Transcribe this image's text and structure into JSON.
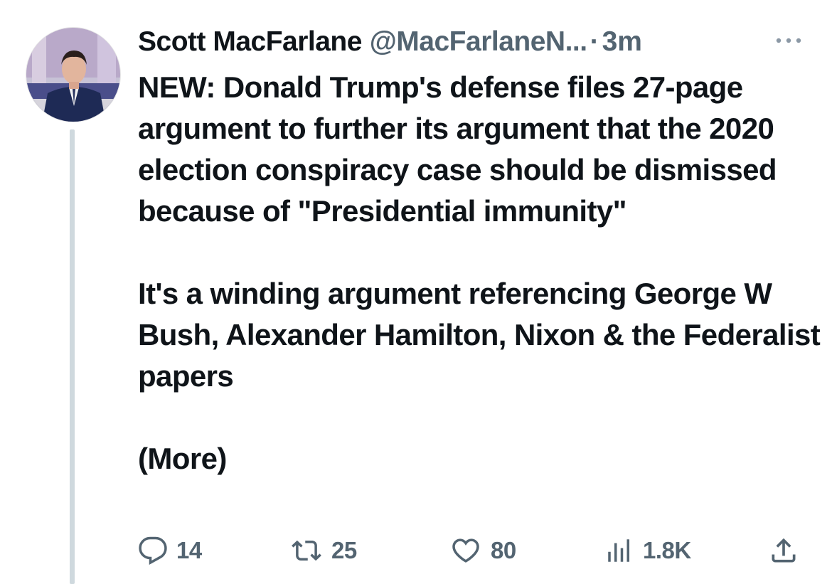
{
  "tweet": {
    "author_name": "Scott MacFarlane",
    "handle": "@MacFarlaneN...",
    "separator": "·",
    "time": "3m",
    "more_icon": "more-horizontal-icon",
    "paragraphs": [
      "NEW:  Donald Trump's defense files 27-page argument to further its argument that the 2020 election conspiracy case should be dismissed because of \"Presidential immunity\"",
      "It's a winding argument referencing George W Bush, Alexander Hamilton, Nixon & the Federalist papers",
      "(More)"
    ]
  },
  "actions": {
    "reply": {
      "icon": "reply-icon",
      "count": "14"
    },
    "retweet": {
      "icon": "retweet-icon",
      "count": "25"
    },
    "like": {
      "icon": "heart-icon",
      "count": "80"
    },
    "views": {
      "icon": "views-chart-icon",
      "count": "1.8K"
    },
    "share": {
      "icon": "share-upload-icon"
    }
  },
  "colors": {
    "text_primary": "#0f1419",
    "text_secondary": "#536471",
    "thread_line": "#cfd9de"
  }
}
